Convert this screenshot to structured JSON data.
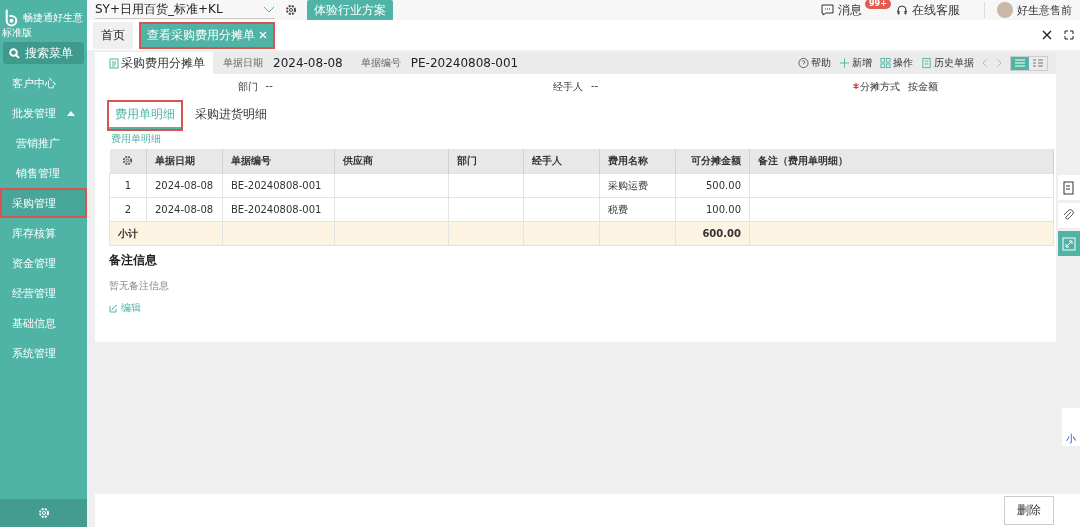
{
  "logo": {
    "name": "畅捷通好生意",
    "edition": "标准版"
  },
  "sidebar": {
    "search": "搜索菜单",
    "items": [
      {
        "label": "客户中心",
        "selected": false,
        "highlighted": false
      },
      {
        "label": "批发管理",
        "selected": false,
        "highlighted": false,
        "expanded": true,
        "children": [
          {
            "label": "营销推广"
          },
          {
            "label": "销售管理"
          }
        ]
      },
      {
        "label": "采购管理",
        "selected": true,
        "highlighted": true
      },
      {
        "label": "库存核算",
        "selected": false,
        "highlighted": false
      },
      {
        "label": "资金管理",
        "selected": false,
        "highlighted": false
      },
      {
        "label": "经营管理",
        "selected": false,
        "highlighted": false
      },
      {
        "label": "基础信息",
        "selected": false,
        "highlighted": false
      },
      {
        "label": "系统管理",
        "selected": false,
        "highlighted": false
      }
    ]
  },
  "topbar": {
    "account": "SY+日用百货_标准+KL",
    "trial_button": "体验行业方案",
    "messages": "消息",
    "badge": "99+",
    "support": "在线客服",
    "user": "好生意售前"
  },
  "tabs": [
    {
      "label": "首页",
      "selected": false,
      "closable": false,
      "highlighted": false
    },
    {
      "label": "查看采购费用分摊单",
      "selected": true,
      "closable": true,
      "highlighted": true
    }
  ],
  "doc": {
    "title": "采购费用分摊单",
    "date_label": "单据日期",
    "date": "2024-08-08",
    "number_label": "单据编号",
    "number": "PE-20240808-001",
    "toolbar": [
      "帮助",
      "新增",
      "操作",
      "历史单据"
    ],
    "fields": [
      {
        "label": "部门",
        "value": "--",
        "required": false
      },
      {
        "label": "经手人",
        "value": "--",
        "required": false
      },
      {
        "label": "分摊方式",
        "value": "按金额",
        "required": true
      }
    ],
    "subtabs": [
      {
        "label": "费用单明细",
        "selected": true,
        "highlighted": true
      },
      {
        "label": "采购进货明细",
        "selected": false,
        "highlighted": false
      }
    ],
    "section_label": "费用单明细",
    "table": {
      "columns": [
        "",
        "单据日期",
        "单据编号",
        "供应商",
        "部门",
        "经手人",
        "费用名称",
        "可分摊金额",
        "备注（费用单明细）"
      ],
      "rows": [
        [
          "1",
          "2024-08-08",
          "BE-20240808-001",
          "",
          "",
          "",
          "采购运费",
          "500.00",
          ""
        ],
        [
          "2",
          "2024-08-08",
          "BE-20240808-001",
          "",
          "",
          "",
          "税费",
          "100.00",
          ""
        ]
      ],
      "subtotal_label": "小计",
      "subtotal": "600.00"
    },
    "notes_title": "备注信息",
    "notes_empty": "暂无备注信息",
    "edit_link": "编辑"
  },
  "side_widget": "小",
  "footer": {
    "delete_button": "删除"
  }
}
